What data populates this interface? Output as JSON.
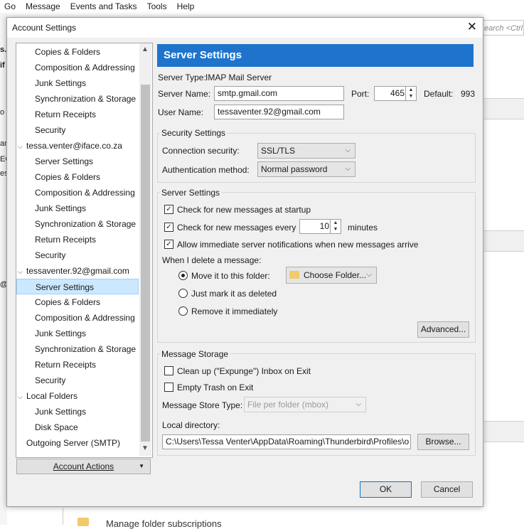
{
  "background": {
    "menu": [
      "Go",
      "Message",
      "Events and Tasks",
      "Tools",
      "Help"
    ],
    "search_placeholder": "earch <Ctrl",
    "bottom_text": "Manage folder subscriptions",
    "left_fragments": [
      "s.c",
      "if",
      "o",
      "an",
      "EC",
      "es",
      "@"
    ]
  },
  "dialog": {
    "title": "Account Settings",
    "close_glyph": "✕"
  },
  "tree": {
    "items": [
      {
        "label": "Copies & Folders",
        "level": 2
      },
      {
        "label": "Composition & Addressing",
        "level": 2
      },
      {
        "label": "Junk Settings",
        "level": 2
      },
      {
        "label": "Synchronization & Storage",
        "level": 2
      },
      {
        "label": "Return Receipts",
        "level": 2
      },
      {
        "label": "Security",
        "level": 2
      },
      {
        "label": "tessa.venter@iface.co.za",
        "level": 1,
        "expanded": true
      },
      {
        "label": "Server Settings",
        "level": 2
      },
      {
        "label": "Copies & Folders",
        "level": 2
      },
      {
        "label": "Composition & Addressing",
        "level": 2
      },
      {
        "label": "Junk Settings",
        "level": 2
      },
      {
        "label": "Synchronization & Storage",
        "level": 2
      },
      {
        "label": "Return Receipts",
        "level": 2
      },
      {
        "label": "Security",
        "level": 2
      },
      {
        "label": "tessaventer.92@gmail.com",
        "level": 1,
        "expanded": true
      },
      {
        "label": "Server Settings",
        "level": 2,
        "selected": true
      },
      {
        "label": "Copies & Folders",
        "level": 2
      },
      {
        "label": "Composition & Addressing",
        "level": 2
      },
      {
        "label": "Junk Settings",
        "level": 2
      },
      {
        "label": "Synchronization & Storage",
        "level": 2
      },
      {
        "label": "Return Receipts",
        "level": 2
      },
      {
        "label": "Security",
        "level": 2
      },
      {
        "label": "Local Folders",
        "level": 1,
        "expanded": true
      },
      {
        "label": "Junk Settings",
        "level": 2
      },
      {
        "label": "Disk Space",
        "level": 2
      },
      {
        "label": "Outgoing Server (SMTP)",
        "level": 1,
        "expanded": false
      }
    ],
    "account_actions": "Account Actions"
  },
  "panel": {
    "header": "Server Settings",
    "server_type_label": "Server Type:",
    "server_type_value": "IMAP Mail Server",
    "server_name_label": "Server Name:",
    "server_name_value": "smtp.gmail.com",
    "port_label": "Port:",
    "port_value": "465",
    "default_label": "Default:",
    "default_value": "993",
    "user_name_label": "User Name:",
    "user_name_value": "tessaventer.92@gmail.com",
    "security": {
      "title": "Security Settings",
      "connection_label": "Connection security:",
      "connection_value": "SSL/TLS",
      "auth_label": "Authentication method:",
      "auth_value": "Normal password"
    },
    "server_settings": {
      "title": "Server Settings",
      "check_startup": "Check for new messages at startup",
      "check_startup_checked": true,
      "check_every": "Check for new messages every",
      "check_every_checked": true,
      "check_every_value": "10",
      "minutes": "minutes",
      "allow_notifications": "Allow immediate server notifications when new messages arrive",
      "allow_notifications_checked": true,
      "when_delete": "When I delete a message:",
      "move_to_folder": "Move it to this folder:",
      "choose_folder": "Choose Folder...",
      "just_mark": "Just mark it as deleted",
      "remove_immediately": "Remove it immediately",
      "selected_option": "move",
      "advanced": "Advanced..."
    },
    "storage": {
      "title": "Message Storage",
      "cleanup": "Clean up (\"Expunge\") Inbox on Exit",
      "cleanup_checked": false,
      "empty_trash": "Empty Trash on Exit",
      "empty_trash_checked": false,
      "store_type_label": "Message Store Type:",
      "store_type_value": "File per folder (mbox)",
      "local_dir_label": "Local directory:",
      "local_dir_value": "C:\\Users\\Tessa Venter\\AppData\\Roaming\\Thunderbird\\Profiles\\o",
      "browse": "Browse..."
    }
  },
  "buttons": {
    "ok": "OK",
    "cancel": "Cancel"
  },
  "colors": {
    "header_blue": "#1e74cd",
    "selection": "#cce8ff"
  }
}
